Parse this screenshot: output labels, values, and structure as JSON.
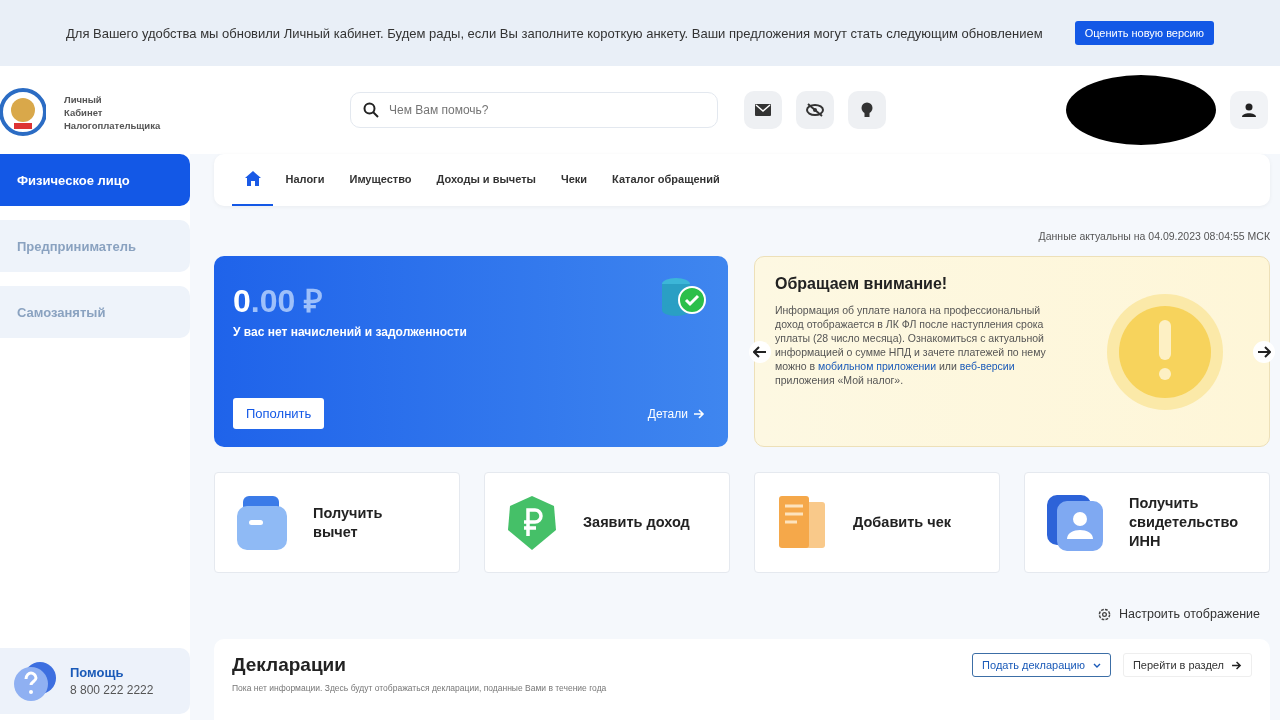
{
  "banner": {
    "text": "Для Вашего удобства мы обновили Личный кабинет. Будем рады, если Вы заполните короткую анкету. Ваши предложения могут стать следующим обновлением",
    "button": "Оценить новую версию"
  },
  "header": {
    "logo_lines": [
      "Личный",
      "Кабинет",
      "Налогоплательщика"
    ],
    "search_placeholder": "Чем Вам помочь?"
  },
  "sidebar": {
    "items": [
      {
        "label": "Физическое лицо",
        "selected": true
      },
      {
        "label": "Предприниматель",
        "selected": false
      },
      {
        "label": "Самозанятый",
        "selected": false
      }
    ],
    "help": {
      "title": "Помощь",
      "phone": "8 800 222 2222"
    }
  },
  "tabs": [
    {
      "kind": "home",
      "selected": true
    },
    {
      "kind": "text",
      "label": "Налоги",
      "selected": false
    },
    {
      "kind": "text",
      "label": "Имущество",
      "selected": false
    },
    {
      "kind": "text",
      "label": "Доходы и вычеты",
      "selected": false
    },
    {
      "kind": "text",
      "label": "Чеки",
      "selected": false
    },
    {
      "kind": "text",
      "label": "Каталог обращений",
      "selected": false
    }
  ],
  "updated": "Данные актуальны на 04.09.2023 08:04:55 МСК",
  "balance": {
    "amount_whole": "0",
    "amount_fraction": ".00 ₽",
    "caption": "У вас нет начислений и задолженности",
    "topup_button": "Пополнить",
    "details_link": "Детали"
  },
  "notice": {
    "title": "Обращаем внимание!",
    "segments": [
      {
        "kind": "text",
        "text": "Информация об уплате налога на профессиональный доход отображается в ЛК ФЛ после наступления срока уплаты (28 число месяца). Ознакомиться с актуальной информацией о сумме НПД и зачете платежей по нему можно в "
      },
      {
        "kind": "link",
        "text": "мобильном приложении"
      },
      {
        "kind": "text",
        "text": " или "
      },
      {
        "kind": "link",
        "text": "веб-версии"
      },
      {
        "kind": "text",
        "text": " приложения «Мой налог»."
      }
    ]
  },
  "actions": [
    {
      "kind": "wallet",
      "label": "Получить вычет"
    },
    {
      "kind": "ruble",
      "label": "Заявить доход"
    },
    {
      "kind": "receipt",
      "label": "Добавить чек"
    },
    {
      "kind": "id",
      "label": "Получить свидетельство ИНН"
    }
  ],
  "settings_link": "Настроить отображение",
  "declarations": {
    "title": "Декларации",
    "submit_button": "Подать декларацию",
    "goto_button": "Перейти в раздел",
    "empty_text": "Пока нет информации. Здесь будут отображаться декларации, поданные Вами в течение года"
  }
}
